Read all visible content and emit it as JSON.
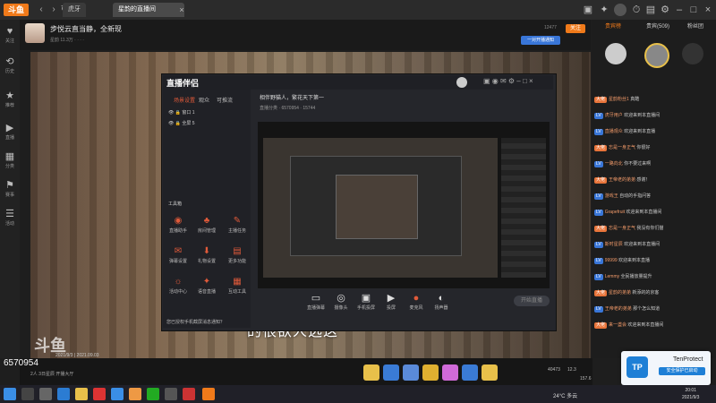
{
  "browser": {
    "logo": "斗鱼",
    "tabs": [
      {
        "label": "虎牙"
      },
      {
        "label": "星韵的直播间"
      }
    ],
    "close": "×",
    "title_icons": [
      "window-icon",
      "gift-icon",
      "user-icon",
      "settings-icon"
    ]
  },
  "sidebar": {
    "items": [
      {
        "label": "关注",
        "icon": "♥"
      },
      {
        "label": "历史",
        "icon": "⟲"
      },
      {
        "label": "推荐",
        "icon": "★"
      },
      {
        "label": "直播",
        "icon": "▶"
      },
      {
        "label": "分类",
        "icon": "▦"
      },
      {
        "label": "赛事",
        "icon": "⚑"
      },
      {
        "label": "活动",
        "icon": "☰"
      }
    ]
  },
  "room": {
    "title": "步悦云直当静，全新现",
    "meta": "星韵  11.3万  ·  ·  ·  ·",
    "count": "12477",
    "btn_a": "一对开播通知",
    "follow": "关注"
  },
  "video": {
    "subtitle": "的很欲人选这",
    "watermark": "斗鱼",
    "wm_time": "2021/9/3 | 2021.09.03"
  },
  "companion": {
    "logo": "直播伴侣",
    "tabs": [
      "场景设置",
      "观众",
      "可推流"
    ],
    "scenes": [
      "窗口 1",
      "全屏 5"
    ],
    "tools_label": "工具箱",
    "tools": [
      {
        "label": "直播助手",
        "icon": "◉"
      },
      {
        "label": "房间管理",
        "icon": "♣"
      },
      {
        "label": "主播任务",
        "icon": "✎"
      },
      {
        "label": "弹幕设置",
        "icon": "✉"
      },
      {
        "label": "礼物设置",
        "icon": "⬇"
      },
      {
        "label": "更多功能",
        "icon": "▤"
      },
      {
        "label": "活动中心",
        "icon": "☼"
      },
      {
        "label": "语音直播",
        "icon": "✦"
      },
      {
        "label": "互动工具",
        "icon": "▦"
      }
    ],
    "user": "相伴野猫人，繁花天下第一",
    "sub": "直播分类 · 6570954 · 15744",
    "bottom": [
      {
        "label": "直播弹幕",
        "icon": "▭"
      },
      {
        "label": "摄像头",
        "icon": "◎"
      },
      {
        "label": "手机投屏",
        "icon": "▣"
      },
      {
        "label": "投屏",
        "icon": "▶"
      },
      {
        "label": "麦克风",
        "icon": "●"
      },
      {
        "label": "扬声器",
        "icon": "◐"
      }
    ],
    "start_live": "开始直播",
    "footer": "您已授权手机截屏消息通知？"
  },
  "right_panel": {
    "tabs": [
      "贵宾榜",
      "贵宾(509)",
      "粉丝团"
    ],
    "chat": [
      {
        "badge": "大佬",
        "name": "星韵粉丝1",
        "text": "真酷"
      },
      {
        "badge": "LV",
        "name": "虎牙用户",
        "text": "欢迎来到本直播间"
      },
      {
        "badge": "LV",
        "name": "直播观众",
        "text": "欢迎来到本直播"
      },
      {
        "badge": "大佬",
        "name": "忘是一身正气",
        "text": "你很好"
      },
      {
        "badge": "LV",
        "name": "一路向北",
        "text": "你不要过来啊"
      },
      {
        "badge": "大佬",
        "name": "王帝老的弟弟",
        "text": "感谢！"
      },
      {
        "badge": "LV",
        "name": "游戏王",
        "text": "自动的手指问答"
      },
      {
        "badge": "LV",
        "name": "Grapefruit",
        "text": "欢迎来到本直播间"
      },
      {
        "badge": "大佬",
        "name": "忘是一身正气",
        "text": "我没有你们猫"
      },
      {
        "badge": "LV",
        "name": "斯时星辰",
        "text": "欢迎来到本直播间"
      },
      {
        "badge": "LV",
        "name": "99999",
        "text": "欢迎来到本直播"
      },
      {
        "badge": "LV",
        "name": "Lemmy",
        "text": "全民播放量提升"
      },
      {
        "badge": "大佬",
        "name": "星韵的弟弟",
        "text": "新添的的京客"
      },
      {
        "badge": "LV",
        "name": "王帝老的弟弟",
        "text": "那个怎么知道"
      },
      {
        "badge": "大佬",
        "name": "来一盏会",
        "text": "欢迎来到本直播间"
      }
    ]
  },
  "tenprotect": {
    "icon": "TP",
    "name": "TenProtect",
    "btn": "安全保护已启动"
  },
  "roombar": {
    "viewers": "6570954",
    "ids": [
      "2人",
      "3日星辰",
      "开播大厅"
    ],
    "stats": [
      "40473",
      "12.3",
      "157.6"
    ]
  },
  "taskbar": {
    "weather": "24°C 多云",
    "time": "20:01",
    "date": "2021/9/3"
  }
}
